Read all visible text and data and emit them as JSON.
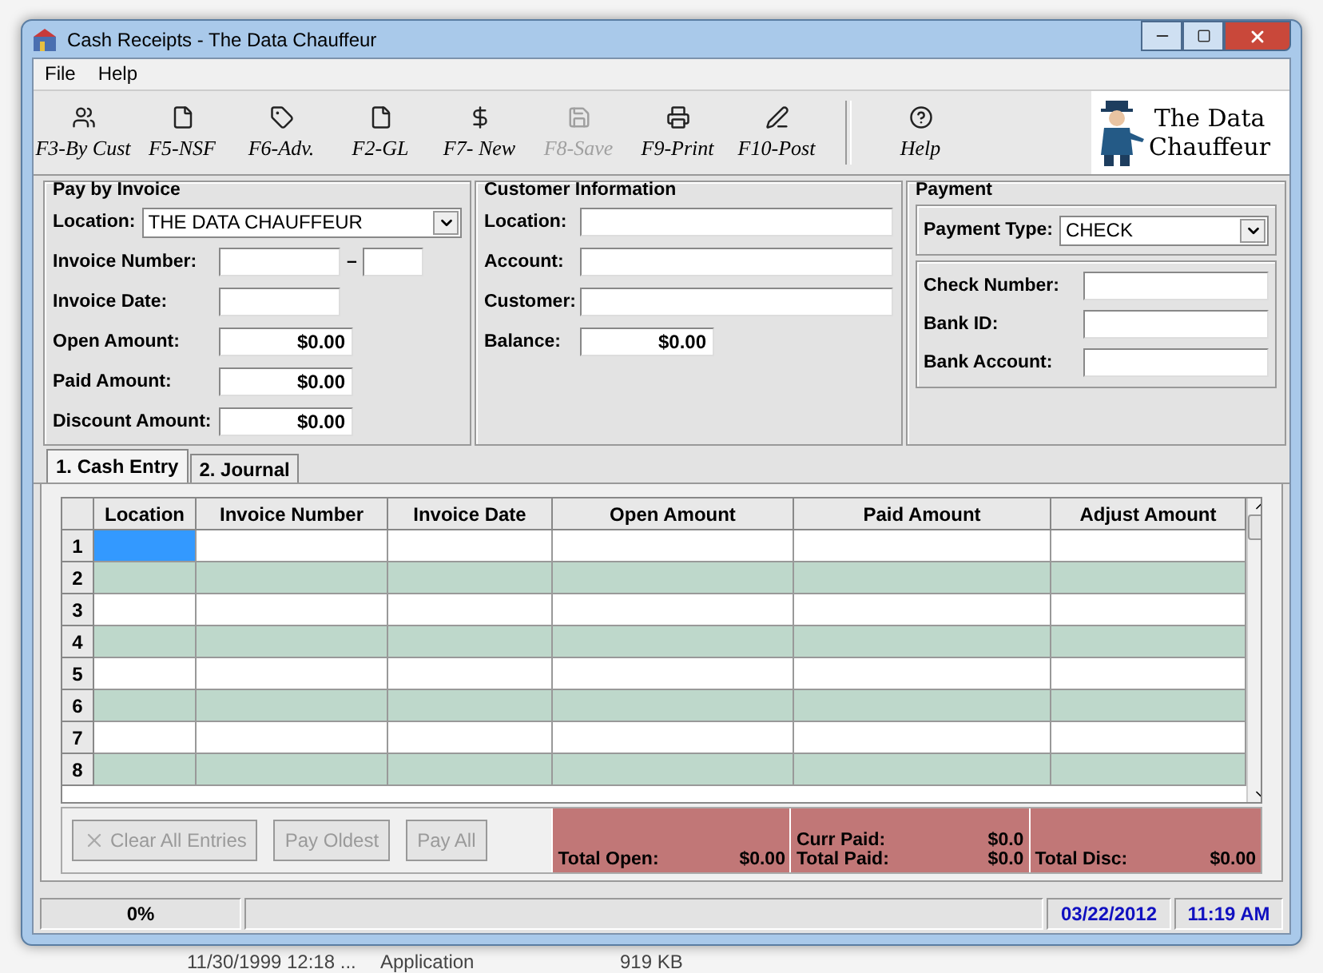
{
  "window": {
    "title": "Cash Receipts - The Data Chauffeur"
  },
  "menu": [
    "File",
    "Help"
  ],
  "toolbar": [
    {
      "label": "F3-By Cust",
      "kind": "customers",
      "disabled": false
    },
    {
      "label": "F5-NSF",
      "kind": "page",
      "disabled": false
    },
    {
      "label": "F6-Adv.",
      "kind": "tag",
      "disabled": false
    },
    {
      "label": "F2-GL",
      "kind": "page",
      "disabled": false
    },
    {
      "label": "F7- New",
      "kind": "dollar",
      "disabled": false
    },
    {
      "label": "F8-Save",
      "kind": "save",
      "disabled": true
    },
    {
      "label": "F9-Print",
      "kind": "print",
      "disabled": false
    },
    {
      "label": "F10-Post",
      "kind": "post",
      "disabled": false
    },
    {
      "label": "Help",
      "kind": "help",
      "disabled": false
    }
  ],
  "logo": {
    "line_1": "The Data",
    "line_2": "Chauffeur"
  },
  "pay_by_invoice": {
    "title": "Pay by Invoice",
    "location_label": "Location:",
    "location_value": "THE DATA CHAUFFEUR",
    "invoice_number_label": "Invoice Number:",
    "separator": "–",
    "invoice_date_label": "Invoice Date:",
    "amounts": [
      {
        "label": "Open Amount:",
        "value": "$0.00"
      },
      {
        "label": "Paid Amount:",
        "value": "$0.00"
      },
      {
        "label": "Discount Amount:",
        "value": "$0.00"
      }
    ]
  },
  "customer_information": {
    "title": "Customer  Information",
    "fields": [
      "Location:",
      "Account:",
      "Customer:"
    ],
    "balance_label": "Balance:",
    "balance_value": "$0.00"
  },
  "payment": {
    "title": "Payment",
    "type_label": "Payment Type:",
    "type_value": "CHECK",
    "fields": [
      "Check Number:",
      "Bank ID:",
      "Bank Account:"
    ]
  },
  "tabs": [
    {
      "label": "1. Cash Entry",
      "selected": true
    },
    {
      "label": "2. Journal",
      "selected": false
    }
  ],
  "table": {
    "columns": [
      "Location",
      "Invoice Number",
      "Invoice Date",
      "Open Amount",
      "Paid Amount",
      "Adjust Amount"
    ],
    "rows": [
      {
        "number": "1",
        "selected": true
      },
      {
        "number": "2",
        "selected": false
      },
      {
        "number": "3",
        "selected": false
      },
      {
        "number": "4",
        "selected": false
      },
      {
        "number": "5",
        "selected": false
      },
      {
        "number": "6",
        "selected": false
      },
      {
        "number": "7",
        "selected": false
      },
      {
        "number": "8",
        "selected": false
      }
    ]
  },
  "actions": [
    {
      "label": "Clear All Entries",
      "disabled": true
    },
    {
      "label": "Pay Oldest",
      "disabled": true
    },
    {
      "label": "Pay All",
      "disabled": true
    }
  ],
  "totals": {
    "total_open_label": "Total Open:",
    "total_open": "$0.00",
    "curr_paid_label": "Curr Paid:",
    "curr_paid": "$0.0",
    "total_paid_label": "Total Paid:",
    "total_paid": "$0.0",
    "total_disc_label": "Total Disc:",
    "total_disc": "$0.00"
  },
  "status_bar": {
    "progress": "0%",
    "date": "03/22/2012",
    "time": "11:19 AM"
  },
  "background_row": [
    "11/30/1999 12:18 ...",
    "Application",
    "919 KB"
  ]
}
